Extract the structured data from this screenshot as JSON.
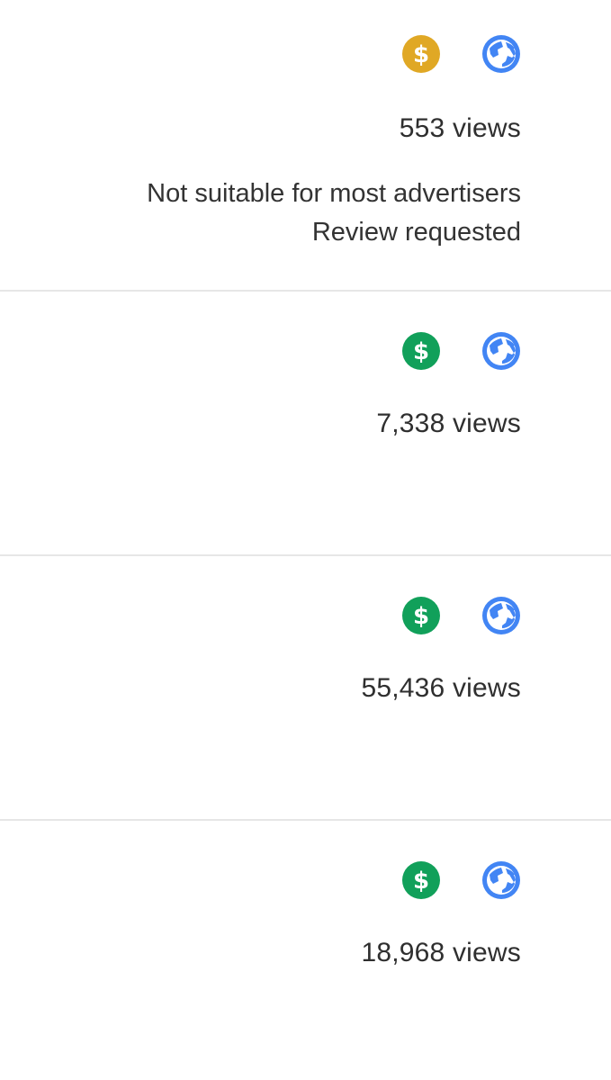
{
  "colors": {
    "monetization_limited": "#E0A825",
    "monetization_on": "#11A05A",
    "visibility_public": "#4285F4",
    "divider": "#E6E6E6",
    "text": "#303030"
  },
  "videos": [
    {
      "monetization_icon": "dollar-icon-limited",
      "visibility_icon": "globe-icon",
      "views": "553 views",
      "status_line_1": "Not suitable for most advertisers",
      "status_line_2": "Review requested"
    },
    {
      "monetization_icon": "dollar-icon",
      "visibility_icon": "globe-icon",
      "views": "7,338 views"
    },
    {
      "monetization_icon": "dollar-icon",
      "visibility_icon": "globe-icon",
      "views": "55,436 views"
    },
    {
      "monetization_icon": "dollar-icon",
      "visibility_icon": "globe-icon",
      "views": "18,968 views"
    }
  ]
}
